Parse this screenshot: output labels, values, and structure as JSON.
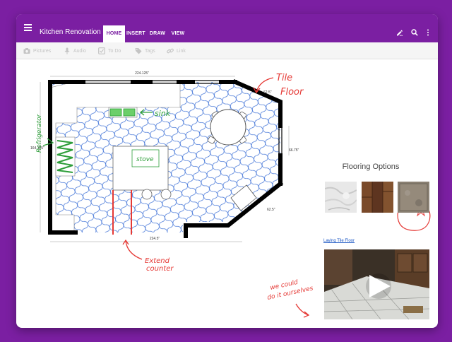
{
  "app": {
    "title": "Kitchen Renovation"
  },
  "tabs": [
    {
      "label": "HOME",
      "active": true
    },
    {
      "label": "INSERT",
      "active": false
    },
    {
      "label": "DRAW",
      "active": false
    },
    {
      "label": "VIEW",
      "active": false
    }
  ],
  "appbar_icons": [
    "pen-icon",
    "search-icon",
    "more-vert-icon"
  ],
  "toolbar": {
    "items": [
      {
        "label": "Pictures",
        "icon": "camera-icon"
      },
      {
        "label": "Audio",
        "icon": "microphone-icon"
      },
      {
        "label": "To Do",
        "icon": "checkbox-icon"
      },
      {
        "label": "Tags",
        "icon": "tag-icon"
      },
      {
        "label": "Link",
        "icon": "link-icon"
      }
    ]
  },
  "floorplan": {
    "dimensions": {
      "top": "224.125\"",
      "left": "164.125\"",
      "bottom": "224.5\"",
      "right": "66.75\"",
      "upper_diagonal": "62.5\"",
      "lower_diagonal": "62.5\""
    },
    "annotations": {
      "refrigerator": "Refrigerator",
      "sink": "sink",
      "stove": "stove",
      "tile_floor_line1": "Tile",
      "tile_floor_line2": "Floor",
      "extend_line1": "Extend",
      "extend_line2": "counter",
      "we_could_line1": "we could",
      "we_could_line2": "do it ourselves"
    }
  },
  "sidebar": {
    "title": "Flooring Options",
    "thumbnails": [
      "marble-tile",
      "wood-plank",
      "stone-tile"
    ],
    "video_link": "Laying Tile Floor"
  },
  "colors": {
    "brand": "#7b1fa2",
    "ink_green": "#2e9e3a",
    "ink_red": "#e53935",
    "tile_pattern": "#3b6fd6",
    "link": "#1a56c4"
  }
}
